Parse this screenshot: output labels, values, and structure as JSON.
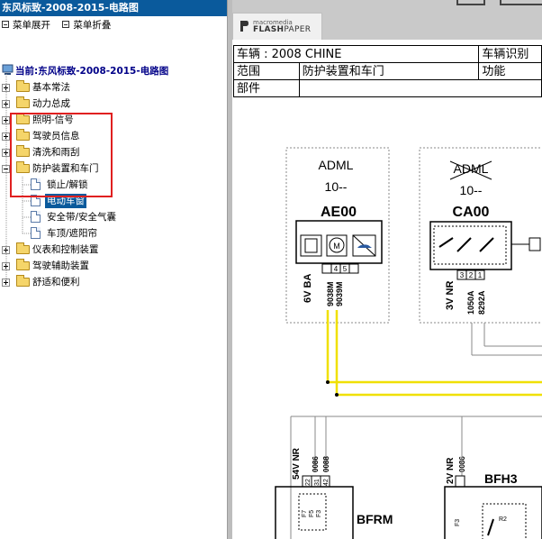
{
  "left_pane": {
    "title": "东风标致-2008-2015-电路图",
    "toolbar": {
      "expand_label": "菜单展开",
      "collapse_label": "菜单折叠"
    },
    "root_label": "当前:东风标致-2008-2015-电路图",
    "tree": [
      {
        "label": "基本常法",
        "expanded": false
      },
      {
        "label": "动力总成",
        "expanded": false
      },
      {
        "label": "照明-信号",
        "expanded": false
      },
      {
        "label": "驾驶员信息",
        "expanded": false
      },
      {
        "label": "清洗和雨刮",
        "expanded": false
      },
      {
        "label": "防护装置和车门",
        "expanded": true
      },
      {
        "label": "锁止/解锁",
        "child": true
      },
      {
        "label": "电动车窗",
        "child": true,
        "selected": true
      },
      {
        "label": "安全带/安全气囊",
        "child": true
      },
      {
        "label": "车顶/遮阳帘",
        "child": true
      },
      {
        "label": "仪表和控制装置",
        "expanded": false
      },
      {
        "label": "驾驶辅助装置",
        "expanded": false
      },
      {
        "label": "舒适和便利",
        "expanded": false
      }
    ]
  },
  "viewer": {
    "logo_small": "macromedia",
    "logo_big_bold": "FLASH",
    "logo_big_rest": "PAPER"
  },
  "document": {
    "header": {
      "vehicle": "车辆 : 2008 CHINE",
      "vehicle_id_label": "车辆识别",
      "scope_label": "范围",
      "scope_value": "防护装置和车门",
      "function_label": "功能",
      "part_label": "部件"
    },
    "blocks": [
      {
        "condition": "ADML",
        "years": "10--",
        "code": "AE00",
        "supply": "6V BA",
        "pins": [
          "4",
          "5"
        ],
        "wires": [
          "9038M",
          "9039M"
        ]
      },
      {
        "condition": "ADML",
        "years": "10--",
        "code": "CA00",
        "supply": "3V NR",
        "pins": [
          "3",
          "2",
          "1"
        ],
        "wires": [
          "1050A",
          "8292A"
        ]
      },
      {
        "code": "BFRM",
        "supply": "54V NR",
        "pins": [
          "22",
          "31",
          "42"
        ],
        "wires": [
          "0086",
          "0088"
        ],
        "sub": [
          "F7",
          "F5",
          "F3"
        ]
      },
      {
        "code": "BFH3",
        "supply": "2V NR",
        "wires": [
          "0086"
        ],
        "sub": [
          "F3",
          "R2"
        ]
      }
    ]
  },
  "colors": {
    "title_bar": "#0a5a9c",
    "wire_yellow": "#f0e000",
    "highlight_box": "#e02020",
    "selection": "#0a5a9c"
  }
}
